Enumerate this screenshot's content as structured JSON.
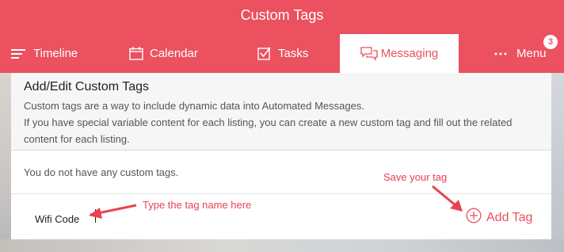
{
  "header": {
    "title": "Custom Tags",
    "tabs": [
      {
        "label": "Timeline",
        "icon": "list-lines-icon"
      },
      {
        "label": "Calendar",
        "icon": "calendar-icon"
      },
      {
        "label": "Tasks",
        "icon": "checkbox-icon"
      },
      {
        "label": "Messaging",
        "icon": "chat-bubbles-icon",
        "active": true
      },
      {
        "label": "Menu",
        "icon": "dots-icon",
        "badge": "3"
      }
    ]
  },
  "card": {
    "title": "Add/Edit Custom Tags",
    "description_line1": "Custom tags are a way to include dynamic data into Automated Messages.",
    "description_line2": "If you have special variable content for each listing, you can create a new custom tag and fill out the related content for each listing.",
    "empty_message": "You do not have any custom tags.",
    "tag_input_value": "Wifi Code",
    "add_tag_label": "Add Tag"
  },
  "annotations": {
    "type_name_hint": "Type the tag name here",
    "save_hint": "Save your tag"
  },
  "colors": {
    "brand": "#eb515f",
    "annotation": "#e8434f"
  }
}
